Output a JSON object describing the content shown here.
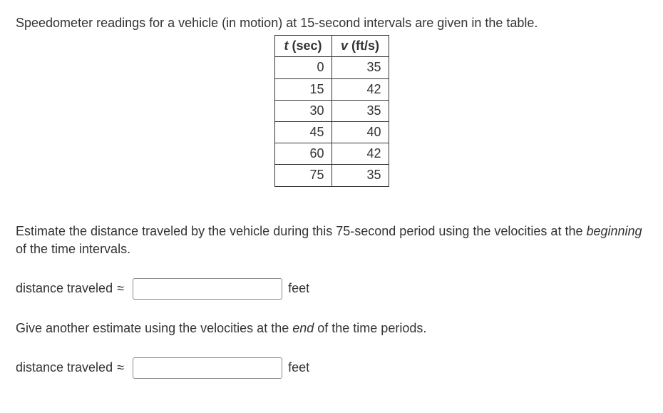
{
  "intro": "Speedometer readings for a vehicle (in motion) at 15-second intervals are given in the table.",
  "table": {
    "header_t_var": "t",
    "header_t_unit": " (sec)",
    "header_v_var": "v",
    "header_v_unit": " (ft/s)",
    "rows": [
      {
        "t": "0",
        "v": "35"
      },
      {
        "t": "15",
        "v": "42"
      },
      {
        "t": "30",
        "v": "35"
      },
      {
        "t": "45",
        "v": "40"
      },
      {
        "t": "60",
        "v": "42"
      },
      {
        "t": "75",
        "v": "35"
      }
    ]
  },
  "question1_a": "Estimate the distance traveled by the vehicle during this 75-second period using the velocities at the ",
  "question1_em": "beginning",
  "question1_b": " of the time intervals.",
  "question2": "Give another estimate using the velocities at the ",
  "question2_em": "end",
  "question2_b": " of the time periods.",
  "answer_label": "distance traveled",
  "approx_symbol": "≈",
  "unit": "feet",
  "chart_data": {
    "type": "table",
    "title": "Speedometer readings at 15-second intervals",
    "columns": [
      "t (sec)",
      "v (ft/s)"
    ],
    "data": [
      [
        0,
        35
      ],
      [
        15,
        42
      ],
      [
        30,
        35
      ],
      [
        45,
        40
      ],
      [
        60,
        42
      ],
      [
        75,
        35
      ]
    ]
  }
}
